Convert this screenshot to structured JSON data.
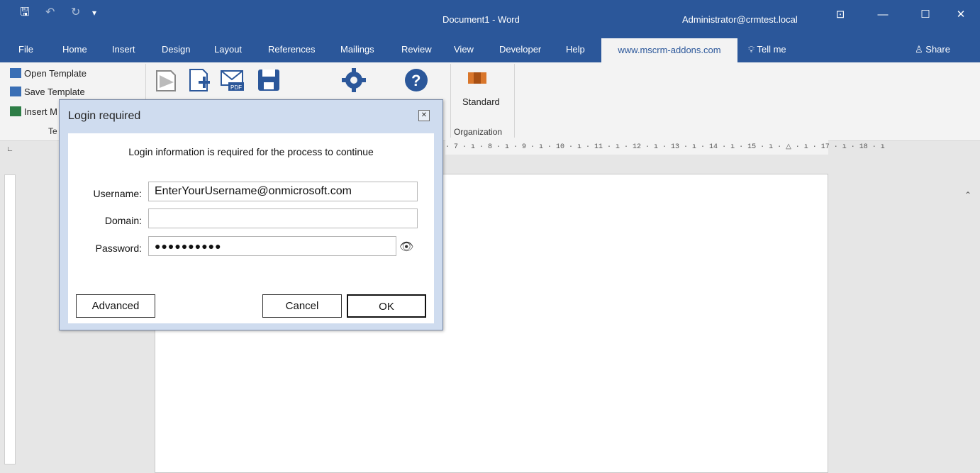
{
  "window": {
    "title": "Document1  -  Word",
    "user": "Administrator@crmtest.local",
    "save_icon": "save-icon",
    "undo_icon": "undo-icon",
    "redo_icon": "redo-icon"
  },
  "menu": {
    "items": [
      "File",
      "Home",
      "Insert",
      "Design",
      "Layout",
      "References",
      "Mailings",
      "Review",
      "View",
      "Developer",
      "Help"
    ],
    "active": "www.mscrm-addons.com",
    "tell_me": "Tell me",
    "share": "Share"
  },
  "ribbon": {
    "open_template": "Open Template",
    "save_template": "Save Template",
    "insert": "Insert M",
    "group_te": "Te",
    "standard": "Standard",
    "organization": "Organization"
  },
  "ruler": "· 7 · ı · 8 · ı · 9 · ı · 10 · ı · 11 · ı · 12 · ı · 13 · ı · 14 · ı · 15 · ı · △ · ı · 17 · ı · 18 · ı",
  "dialog": {
    "title": "Login required",
    "message": "Login information is required for the process to continue",
    "username_label": "Username:",
    "username_value": "EnterYourUsername@onmicrosoft.com",
    "domain_label": "Domain:",
    "domain_value": "",
    "password_label": "Password:",
    "password_value": "●●●●●●●●●●",
    "advanced": "Advanced",
    "cancel": "Cancel",
    "ok": "OK"
  }
}
